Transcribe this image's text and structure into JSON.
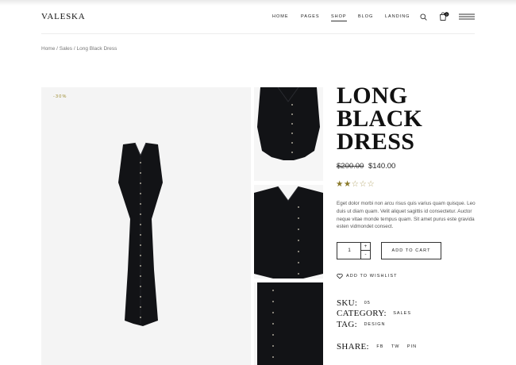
{
  "header": {
    "logo": "VALESKA",
    "nav": [
      {
        "label": "HOME",
        "active": false
      },
      {
        "label": "PAGES",
        "active": false
      },
      {
        "label": "SHOP",
        "active": true
      },
      {
        "label": "BLOG",
        "active": false
      },
      {
        "label": "LANDING",
        "active": false
      }
    ],
    "cart_count": "0",
    "icons": [
      "search-icon",
      "cart-icon",
      "hamburger-menu-icon"
    ]
  },
  "breadcrumb": {
    "items": [
      "Home",
      "Sales",
      "Long Black Dress"
    ],
    "separator": "/"
  },
  "gallery": {
    "sale_badge": "-30%"
  },
  "product": {
    "title_lines": [
      "LONG",
      "BLACK",
      "DRESS"
    ],
    "old_price": "$200.00",
    "price": "$140.00",
    "rating": 2,
    "rating_max": 5,
    "description": "Eget dolor morbi non arcu risus quis varius quam quisque. Leo duis ut diam quam. Velit aliquet sagittis id consectetur. Auctor neque vitae monde tempus quam. Sit amet purus este gravida esten vidmondet consect.",
    "quantity": "1",
    "qty_plus": "+",
    "qty_minus": "-",
    "add_to_cart": "ADD TO CART",
    "wishlist": "ADD TO WISHLIST"
  },
  "meta": {
    "sku_label": "SKU:",
    "sku": "05",
    "category_label": "CATEGORY:",
    "category": "SALES",
    "tag_label": "TAG:",
    "tag": "DESIGN",
    "share_label": "SHARE:",
    "share_links": [
      "FB",
      "TW",
      "PIN"
    ]
  },
  "colors": {
    "accent": "#9b8a2c",
    "star": "#8a7a2a",
    "dress": "#121316",
    "button": "#pin-reference-unused"
  }
}
